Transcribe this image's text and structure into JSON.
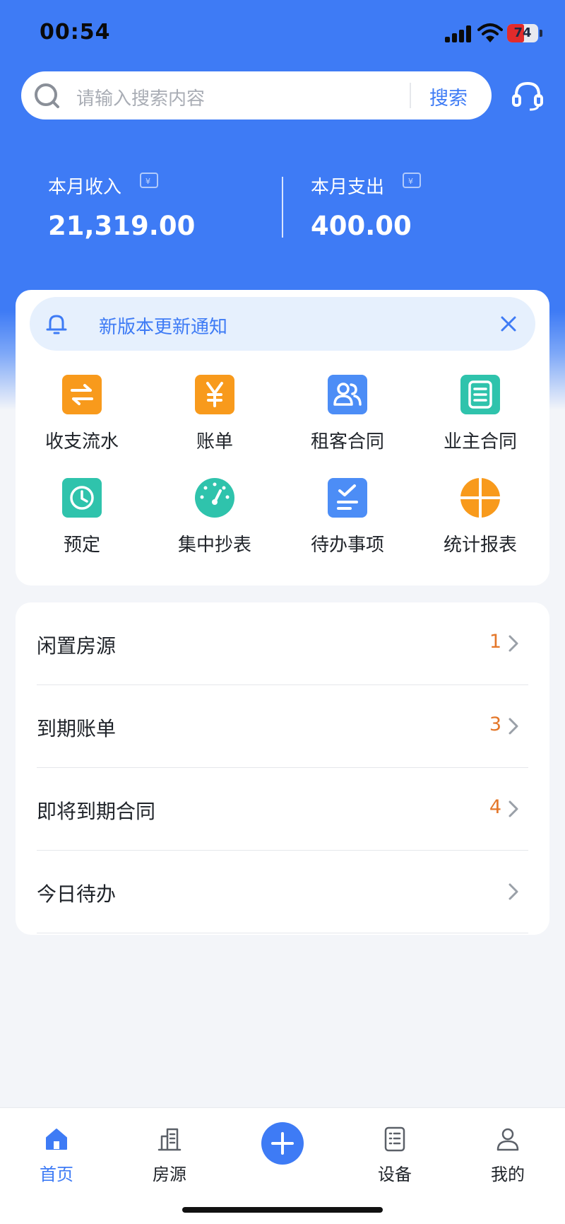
{
  "status_bar": {
    "time": "00:54",
    "battery": "74"
  },
  "search": {
    "placeholder": "请输入搜索内容",
    "button_label": "搜索"
  },
  "summary": {
    "income_label": "本月收入",
    "income_value": "21,319.00",
    "expense_label": "本月支出",
    "expense_value": "400.00"
  },
  "notice": {
    "text": "新版本更新通知"
  },
  "quick_actions": [
    {
      "label": "收支流水",
      "icon": "transfer-icon",
      "color": "#f89a1c"
    },
    {
      "label": "账单",
      "icon": "yen-icon",
      "color": "#f89a1c"
    },
    {
      "label": "租客合同",
      "icon": "tenant-icon",
      "color": "#4c8df6"
    },
    {
      "label": "业主合同",
      "icon": "list-icon",
      "color": "#2fc3ac"
    },
    {
      "label": "预定",
      "icon": "clock-icon",
      "color": "#2fc3ac"
    },
    {
      "label": "集中抄表",
      "icon": "meter-icon",
      "color": "#2fc3ac"
    },
    {
      "label": "待办事项",
      "icon": "todo-icon",
      "color": "#4c8df6"
    },
    {
      "label": "统计报表",
      "icon": "pie-icon",
      "color": "#f89a1c"
    }
  ],
  "list": [
    {
      "label": "闲置房源",
      "count": "1"
    },
    {
      "label": "到期账单",
      "count": "3"
    },
    {
      "label": "即将到期合同",
      "count": "4"
    },
    {
      "label": "今日待办",
      "count": ""
    }
  ],
  "tabs": [
    {
      "label": "首页",
      "icon": "home-icon"
    },
    {
      "label": "房源",
      "icon": "building-icon"
    },
    {
      "label": "设备",
      "icon": "device-icon"
    },
    {
      "label": "我的",
      "icon": "user-icon"
    }
  ],
  "colors": {
    "primary": "#3e7bf5",
    "count": "#e4772a",
    "background": "#f3f5f9"
  }
}
